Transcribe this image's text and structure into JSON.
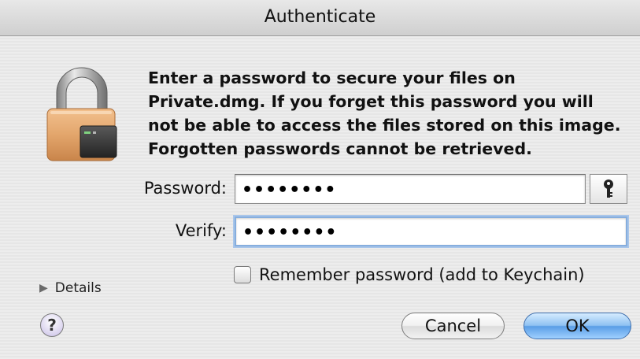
{
  "window": {
    "title": "Authenticate"
  },
  "dialog": {
    "icon": "padlock-disk-image-icon",
    "message_lines": [
      "Enter a password to secure your files on",
      "Private.dmg.  If you forget this password you will",
      "not be able to access the files stored on this image.",
      "Forgotten passwords cannot be retrieved."
    ]
  },
  "form": {
    "password_label": "Password:",
    "password_value": "••••••••",
    "key_button_icon": "key-icon",
    "verify_label": "Verify:",
    "verify_value": "••••••••",
    "remember_label": "Remember password (add to Keychain)",
    "remember_checked": false
  },
  "footer": {
    "details_label": "Details",
    "help_label": "?",
    "cancel_label": "Cancel",
    "ok_label": "OK"
  },
  "colors": {
    "focus_ring": "#86aede",
    "default_button": "#5a9ee6",
    "lock_body": "#e0a56c"
  }
}
